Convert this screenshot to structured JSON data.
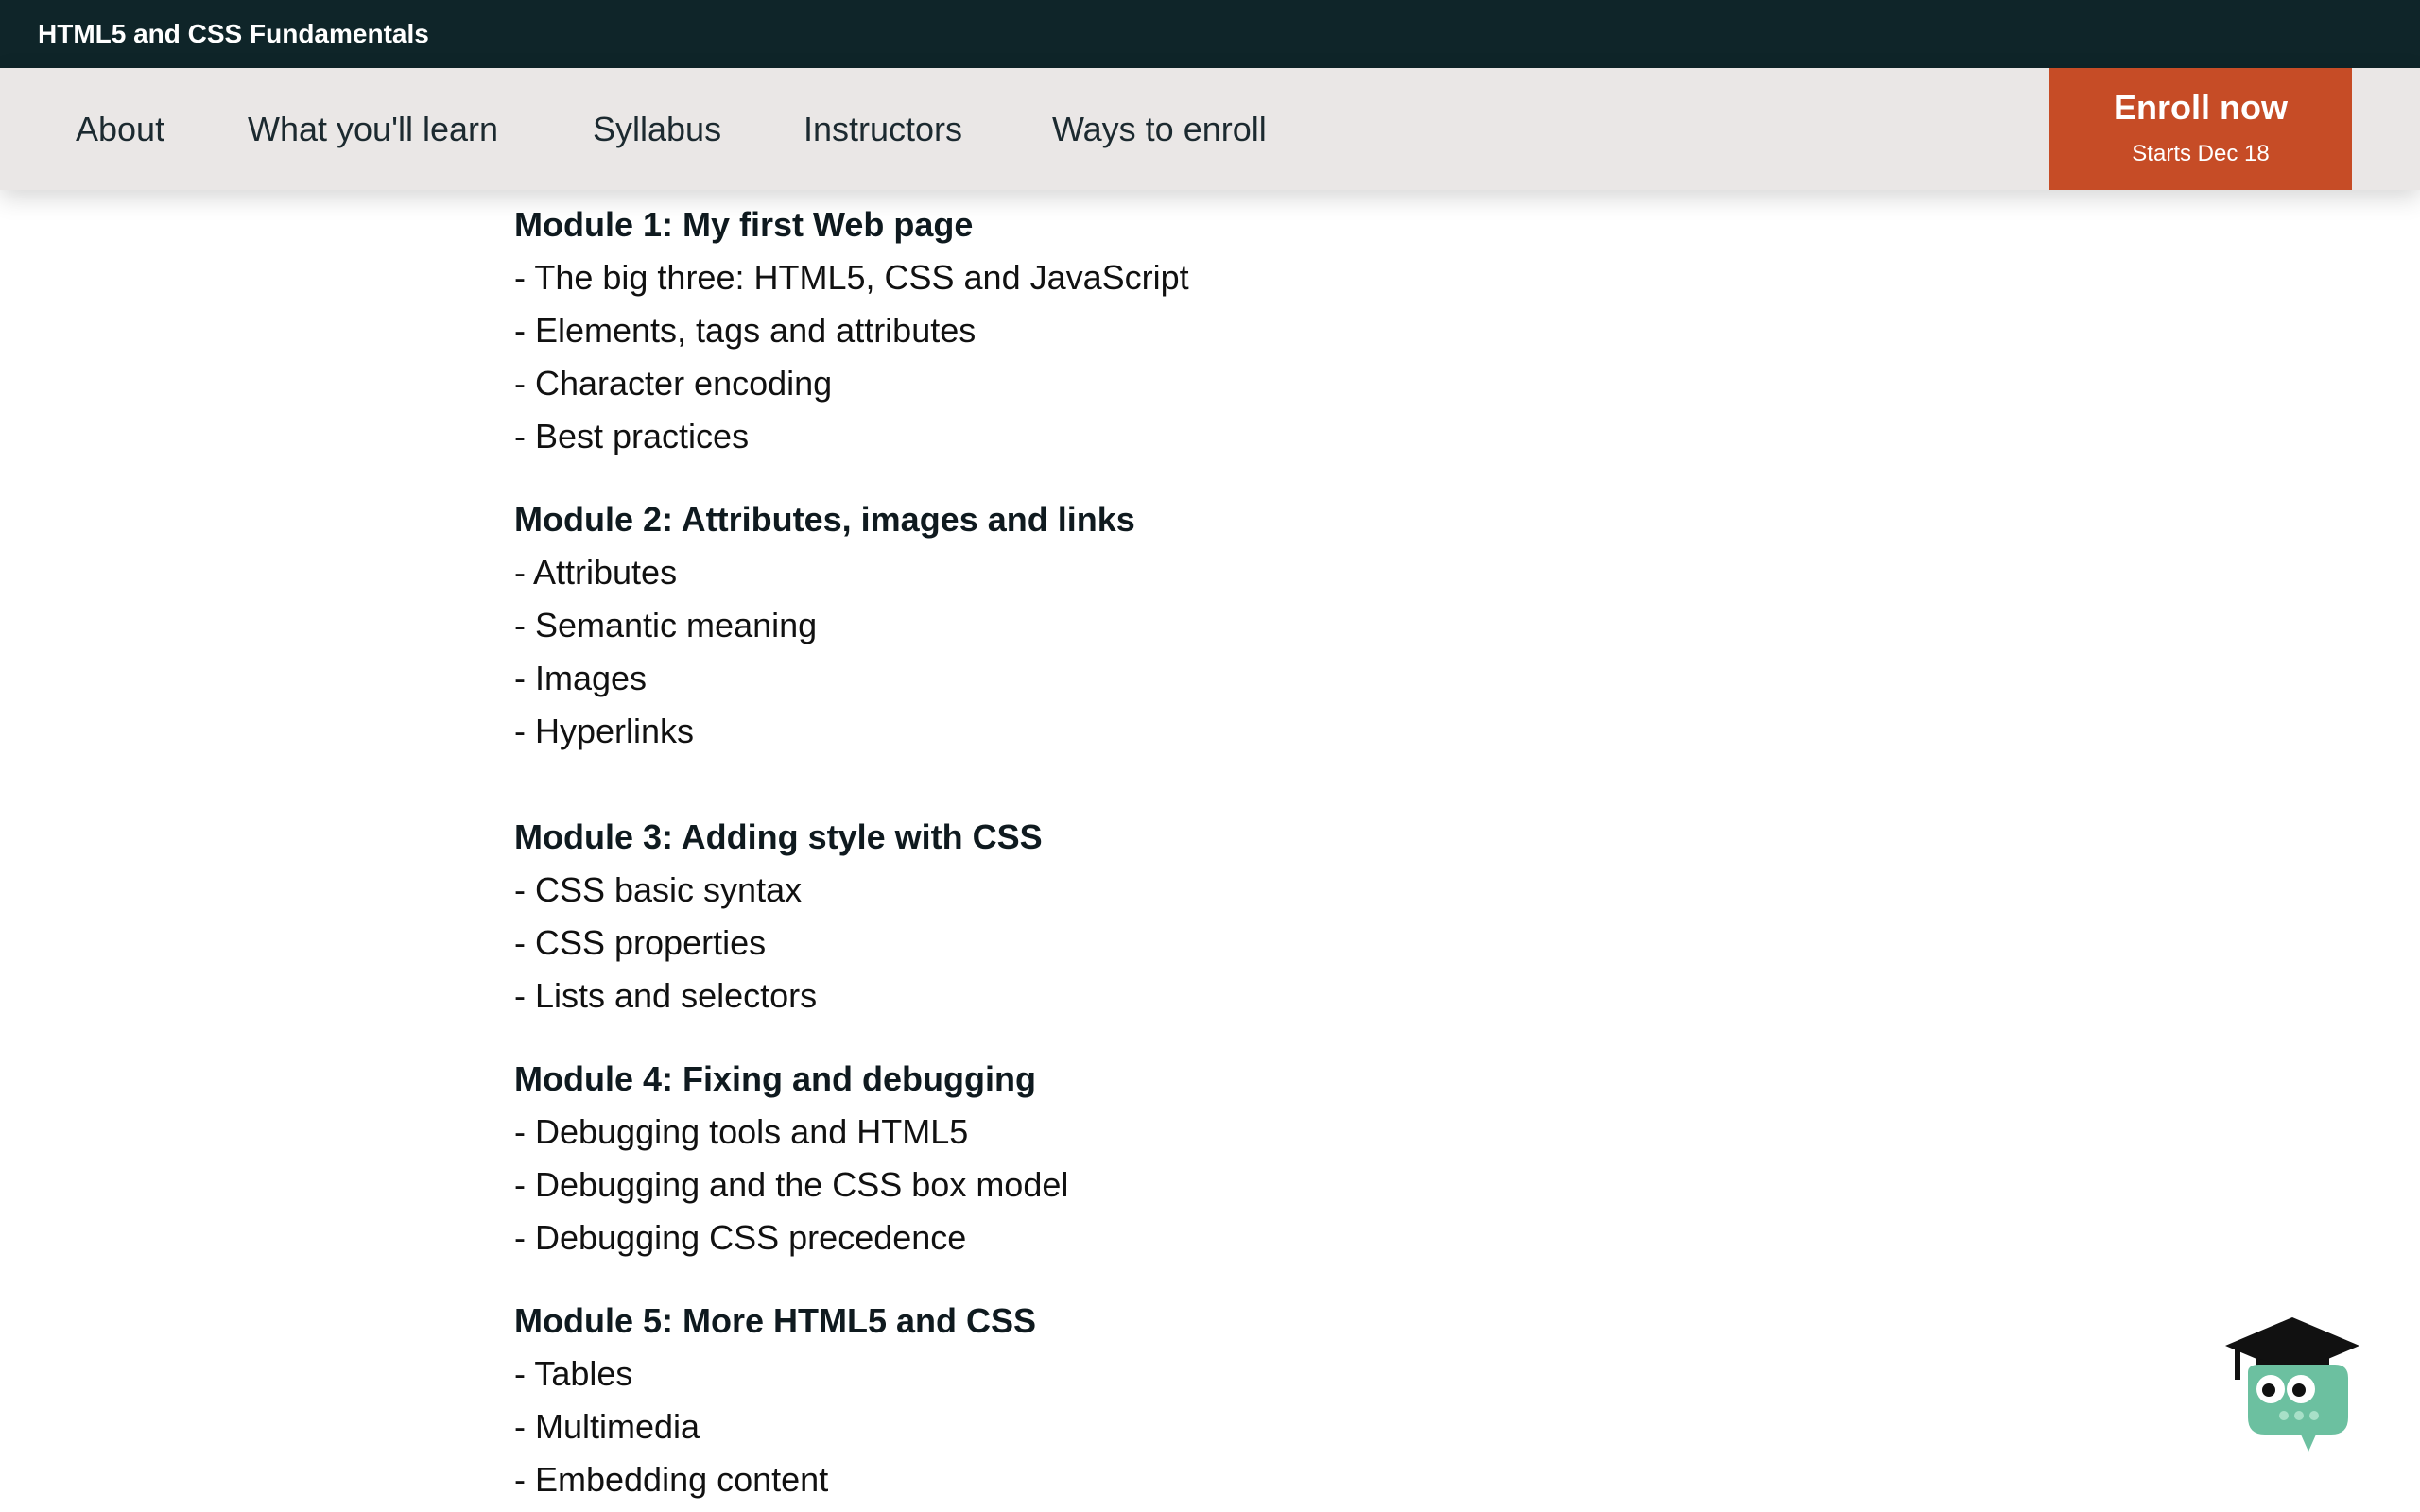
{
  "header": {
    "course_title": "HTML5 and CSS Fundamentals"
  },
  "nav": {
    "links": [
      "About",
      "What you'll learn",
      "Syllabus",
      "Instructors",
      "Ways to enroll"
    ],
    "enroll": {
      "label": "Enroll now",
      "sub": "Starts Dec 18"
    }
  },
  "modules": [
    {
      "title": "Module 1: My first Web page",
      "items": [
        "- The big three: HTML5, CSS and JavaScript",
        "- Elements, tags and attributes",
        "- Character encoding",
        "- Best practices"
      ]
    },
    {
      "title": "Module 2: Attributes, images and links",
      "items": [
        "- Attributes",
        "- Semantic meaning",
        "- Images",
        "- Hyperlinks"
      ]
    },
    {
      "title": "Module 3: Adding style with CSS",
      "items": [
        "- CSS basic syntax",
        "- CSS properties",
        "- Lists and selectors"
      ]
    },
    {
      "title": "Module 4: Fixing and debugging",
      "items": [
        "- Debugging tools and HTML5",
        "- Debugging and the CSS box model",
        "- Debugging CSS precedence"
      ]
    },
    {
      "title": "Module 5: More HTML5 and CSS",
      "items": [
        "- Tables",
        "- Multimedia",
        "- Embedding content"
      ]
    }
  ],
  "icons": {
    "chat_mascot": "graduation-cap-chatbot-icon"
  },
  "colors": {
    "topbar_bg": "#0f2529",
    "navbar_bg": "#eae7e6",
    "enroll_bg": "#c64c26",
    "mascot_body": "#6cc0a0"
  }
}
